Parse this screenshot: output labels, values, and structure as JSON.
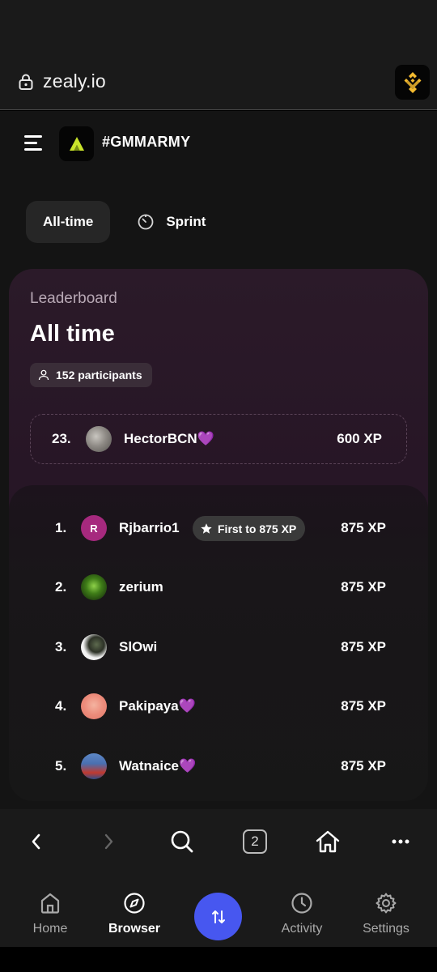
{
  "browser": {
    "url": "zealy.io",
    "wallet_icon": "bnb-logo-icon"
  },
  "header": {
    "community_name": "#GMMARMY"
  },
  "tabs": [
    {
      "label": "All-time",
      "active": true
    },
    {
      "label": "Sprint",
      "active": false,
      "icon": "timer-icon"
    }
  ],
  "leaderboard": {
    "label": "Leaderboard",
    "title": "All time",
    "participants": "152 participants",
    "me": {
      "rank": "23.",
      "name": "HectorBCN💜",
      "xp": "600 XP"
    },
    "rows": [
      {
        "rank": "1.",
        "name": "Rjbarrio1",
        "xp": "875 XP",
        "avatar_letter": "R",
        "badge": "First to 875 XP"
      },
      {
        "rank": "2.",
        "name": "zerium",
        "xp": "875 XP"
      },
      {
        "rank": "3.",
        "name": "SlOwi",
        "xp": "875 XP"
      },
      {
        "rank": "4.",
        "name": "Pakipaya💜",
        "xp": "875 XP"
      },
      {
        "rank": "5.",
        "name": "Watnaice💜",
        "xp": "875 XP"
      }
    ]
  },
  "browser_nav": {
    "tab_count": "2"
  },
  "bottom_nav": [
    {
      "label": "Home",
      "icon": "home-icon"
    },
    {
      "label": "Browser",
      "icon": "compass-icon",
      "active": true
    },
    {
      "label": "Activity",
      "icon": "clock-icon"
    },
    {
      "label": "Settings",
      "icon": "gear-icon"
    }
  ],
  "colors": {
    "accent": "#4757f0",
    "card": "#2b1a29",
    "avatar_r": "#a6297e"
  }
}
